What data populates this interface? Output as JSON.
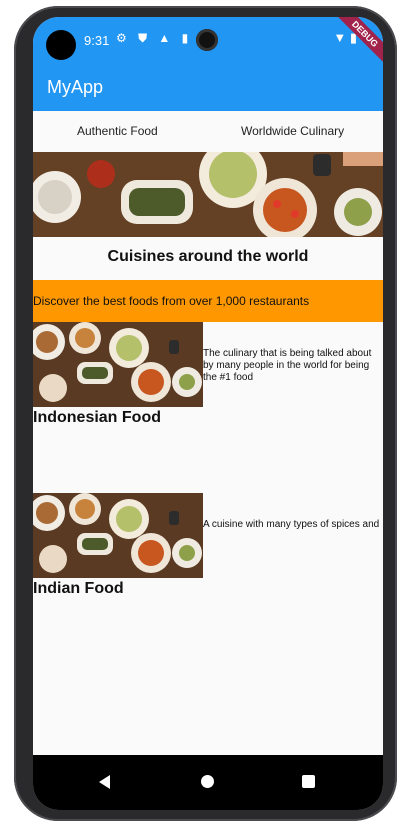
{
  "status_bar": {
    "time": "9:31",
    "debug_label": "DEBUG"
  },
  "app_bar": {
    "title": "MyApp"
  },
  "tabs": [
    {
      "label": "Authentic Food"
    },
    {
      "label": "Worldwide Culinary"
    }
  ],
  "main": {
    "heading": "Cuisines around the world",
    "banner_text": "Discover the best foods from over 1,000 restaurants",
    "cards": [
      {
        "title": "Indonesian Food",
        "description": "The culinary that is being talked about by many people in the world for being the #1 food"
      },
      {
        "title": "Indian Food",
        "description": "A cuisine with many types of spices and"
      }
    ]
  },
  "colors": {
    "primary": "#2196f3",
    "banner": "#ff9800",
    "debug_ribbon": "#a1224a"
  }
}
